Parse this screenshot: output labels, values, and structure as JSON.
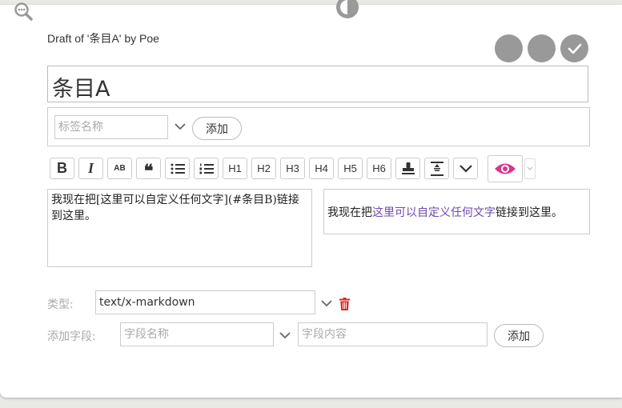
{
  "header": {
    "draft_title": "Draft of '条目A' by Poe"
  },
  "icons": {
    "zoom": "zoom-out-icon",
    "contrast": "contrast-icon",
    "confirm": "checkmark-icon"
  },
  "colors": {
    "circle_buttons": "#999999",
    "preview_eye": "#d9368f",
    "link": "#6d4ab3",
    "delete": "#e02424"
  },
  "editor": {
    "title": "条目A",
    "tag_placeholder": "标签名称",
    "tag_add_label": "添加",
    "toolbar": [
      "B",
      "I",
      "AB",
      "❝",
      "•≡",
      "1≡",
      "H1",
      "H2",
      "H3",
      "H4",
      "H5",
      "H6",
      "stamp",
      "excise",
      "more"
    ],
    "body_text": "我现在把[这里可以自定义任何文字](#条目B)链接到这里。"
  },
  "preview": {
    "before": "我现在把",
    "link_text": "这里可以自定义任何文字",
    "after": "链接到这里。"
  },
  "fields": {
    "type_label": "类型:",
    "type_value": "text/x-markdown",
    "add_field_label": "添加字段:",
    "field_name_placeholder": "字段名称",
    "field_value_placeholder": "字段内容",
    "add_label": "添加"
  }
}
